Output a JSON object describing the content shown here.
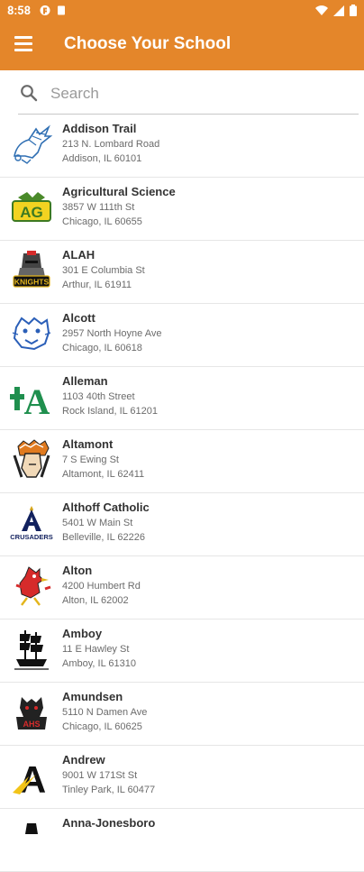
{
  "status": {
    "time": "8:58"
  },
  "appbar": {
    "title": "Choose Your School"
  },
  "search": {
    "placeholder": "Search"
  },
  "schools": [
    {
      "name": "Addison Trail",
      "street": "213 N. Lombard Road",
      "city": "Addison, IL 60101"
    },
    {
      "name": "Agricultural Science",
      "street": "3857 W 111th St",
      "city": "Chicago, IL 60655"
    },
    {
      "name": "ALAH",
      "street": "301 E Columbia St",
      "city": "Arthur, IL 61911"
    },
    {
      "name": "Alcott",
      "street": "2957 North Hoyne Ave",
      "city": "Chicago, IL 60618"
    },
    {
      "name": "Alleman",
      "street": "1103 40th Street",
      "city": "Rock Island, IL 61201"
    },
    {
      "name": "Altamont",
      "street": "7 S Ewing St",
      "city": "Altamont, IL 62411"
    },
    {
      "name": "Althoff Catholic",
      "street": "5401 W Main St",
      "city": "Belleville, IL 62226"
    },
    {
      "name": "Alton",
      "street": "4200 Humbert Rd",
      "city": "Alton, IL 62002"
    },
    {
      "name": "Amboy",
      "street": "11 E Hawley St",
      "city": "Amboy, IL 61310"
    },
    {
      "name": "Amundsen",
      "street": "5110 N Damen Ave",
      "city": "Chicago, IL 60625"
    },
    {
      "name": "Andrew",
      "street": "9001 W 171St St",
      "city": "Tinley Park, IL 60477"
    },
    {
      "name": "Anna-Jonesboro",
      "street": "",
      "city": ""
    }
  ],
  "logos": {
    "ag_text": "AG",
    "alah_text": "KNIGHTS",
    "alleman_text": "A",
    "althoff_text": "CRUSADERS",
    "amundsen_text": "AHS",
    "andrew_text": "A"
  },
  "colors": {
    "accent": "#e4862a",
    "divider": "#e6e6e6",
    "name_text": "#333333",
    "sub_text": "#6b6b6b"
  }
}
